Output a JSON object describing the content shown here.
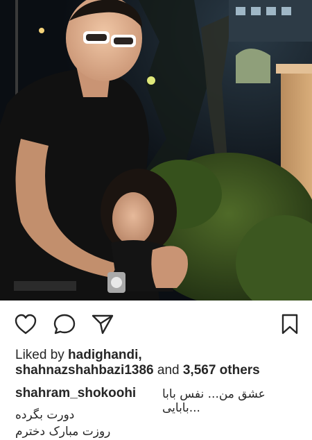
{
  "post": {
    "image_alt": "Man in black t-shirt and glasses hugging a young girl at night in front of bushes"
  },
  "actions": {
    "like_icon": "heart-icon",
    "comment_icon": "comment-icon",
    "share_icon": "paper-plane-icon",
    "save_icon": "bookmark-icon"
  },
  "likes": {
    "prefix": "Liked by ",
    "user1": "hadighandi,",
    "user2": "shahnazshahbazi1386",
    "middle": " and ",
    "others": "3,567 others"
  },
  "caption": {
    "username": "shahram_shokoohi",
    "line1": "عشق من... نفس بابا ...بابایی",
    "line2": "دورت بگرده",
    "line3": "روزت مبارک دخترم"
  },
  "colors": {
    "text": "#262626",
    "background": "#ffffff"
  }
}
